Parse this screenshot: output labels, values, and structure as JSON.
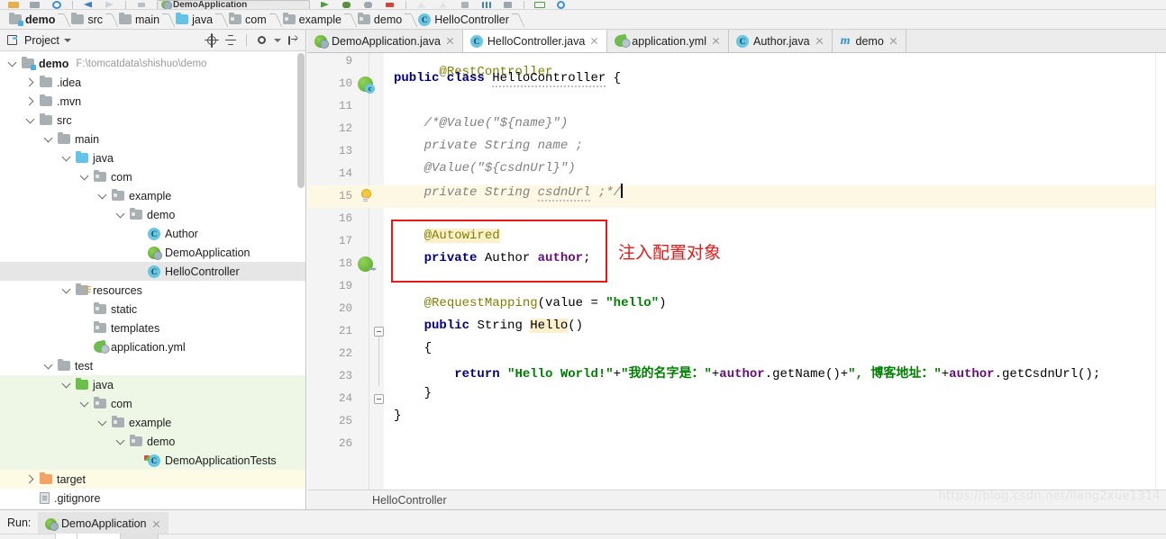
{
  "toolbar": {
    "run_config_label": "DemoApplication",
    "icons": [
      "open-folder-icon",
      "save-all-icon",
      "sync-icon",
      "back-icon",
      "forward-icon",
      "build-icon",
      "run-icon",
      "debug-icon",
      "coverage-icon",
      "stop-icon",
      "profile-icon",
      "analyze-icon",
      "update-icon",
      "structure-icon",
      "commit-icon",
      "terminal-icon",
      "search-icon"
    ]
  },
  "breadcrumb": {
    "items": [
      {
        "label": "demo",
        "icon": "module-folder-icon",
        "bold": true
      },
      {
        "label": "src",
        "icon": "folder-icon",
        "bold": false
      },
      {
        "label": "main",
        "icon": "folder-icon",
        "bold": false
      },
      {
        "label": "java",
        "icon": "source-folder-icon",
        "bold": false
      },
      {
        "label": "com",
        "icon": "package-icon",
        "bold": false
      },
      {
        "label": "example",
        "icon": "package-icon",
        "bold": false
      },
      {
        "label": "demo",
        "icon": "package-icon",
        "bold": false
      },
      {
        "label": "HelloController",
        "icon": "java-class-icon",
        "bold": false
      }
    ]
  },
  "project_panel": {
    "title": "Project",
    "toolbar_icons": [
      "locate-icon",
      "collapse-all-icon",
      "settings-icon",
      "hide-icon"
    ],
    "tree": [
      {
        "label": "demo",
        "path": "F:\\tomcatdata\\shishuo\\demo",
        "icon": "module-folder-icon",
        "indent": 0,
        "arrow": "down",
        "bold": true,
        "state": "none"
      },
      {
        "label": ".idea",
        "path": "",
        "icon": "folder-icon",
        "indent": 1,
        "arrow": "right",
        "bold": false,
        "state": "none"
      },
      {
        "label": ".mvn",
        "path": "",
        "icon": "folder-icon",
        "indent": 1,
        "arrow": "right",
        "bold": false,
        "state": "none"
      },
      {
        "label": "src",
        "path": "",
        "icon": "folder-icon",
        "indent": 1,
        "arrow": "down",
        "bold": false,
        "state": "none"
      },
      {
        "label": "main",
        "path": "",
        "icon": "folder-icon",
        "indent": 2,
        "arrow": "down",
        "bold": false,
        "state": "none"
      },
      {
        "label": "java",
        "path": "",
        "icon": "source-folder-icon",
        "indent": 3,
        "arrow": "down",
        "bold": false,
        "state": "none"
      },
      {
        "label": "com",
        "path": "",
        "icon": "package-icon",
        "indent": 4,
        "arrow": "down",
        "bold": false,
        "state": "none"
      },
      {
        "label": "example",
        "path": "",
        "icon": "package-icon",
        "indent": 5,
        "arrow": "down",
        "bold": false,
        "state": "none"
      },
      {
        "label": "demo",
        "path": "",
        "icon": "package-icon",
        "indent": 6,
        "arrow": "down",
        "bold": false,
        "state": "none"
      },
      {
        "label": "Author",
        "path": "",
        "icon": "java-class-icon",
        "indent": 7,
        "arrow": "none",
        "bold": false,
        "state": "none"
      },
      {
        "label": "DemoApplication",
        "path": "",
        "icon": "spring-boot-icon",
        "indent": 7,
        "arrow": "none",
        "bold": false,
        "state": "none"
      },
      {
        "label": "HelloController",
        "path": "",
        "icon": "java-class-icon",
        "indent": 7,
        "arrow": "none",
        "bold": false,
        "state": "selected"
      },
      {
        "label": "resources",
        "path": "",
        "icon": "resources-folder-icon",
        "indent": 3,
        "arrow": "down",
        "bold": false,
        "state": "none"
      },
      {
        "label": "static",
        "path": "",
        "icon": "package-icon",
        "indent": 4,
        "arrow": "none",
        "bold": false,
        "state": "none"
      },
      {
        "label": "templates",
        "path": "",
        "icon": "package-icon",
        "indent": 4,
        "arrow": "none",
        "bold": false,
        "state": "none"
      },
      {
        "label": "application.yml",
        "path": "",
        "icon": "spring-yaml-icon",
        "indent": 4,
        "arrow": "none",
        "bold": false,
        "state": "none"
      },
      {
        "label": "test",
        "path": "",
        "icon": "folder-icon",
        "indent": 2,
        "arrow": "down",
        "bold": false,
        "state": "none"
      },
      {
        "label": "java",
        "path": "",
        "icon": "test-source-folder-icon",
        "indent": 3,
        "arrow": "down",
        "bold": false,
        "state": "green"
      },
      {
        "label": "com",
        "path": "",
        "icon": "package-icon",
        "indent": 4,
        "arrow": "down",
        "bold": false,
        "state": "green"
      },
      {
        "label": "example",
        "path": "",
        "icon": "package-icon",
        "indent": 5,
        "arrow": "down",
        "bold": false,
        "state": "green"
      },
      {
        "label": "demo",
        "path": "",
        "icon": "package-icon",
        "indent": 6,
        "arrow": "down",
        "bold": false,
        "state": "green"
      },
      {
        "label": "DemoApplicationTests",
        "path": "",
        "icon": "java-test-class-icon",
        "indent": 7,
        "arrow": "none",
        "bold": false,
        "state": "green"
      },
      {
        "label": "target",
        "path": "",
        "icon": "excluded-folder-icon",
        "indent": 1,
        "arrow": "right",
        "bold": false,
        "state": "yellow"
      },
      {
        "label": ".gitignore",
        "path": "",
        "icon": "gitignore-file-icon",
        "indent": 1,
        "arrow": "none",
        "bold": false,
        "state": "none"
      }
    ]
  },
  "editor_tabs": [
    {
      "label": "DemoApplication.java",
      "icon": "spring-boot-icon",
      "active": false
    },
    {
      "label": "HelloController.java",
      "icon": "java-class-icon",
      "active": true
    },
    {
      "label": "application.yml",
      "icon": "spring-yaml-icon",
      "active": false
    },
    {
      "label": "Author.java",
      "icon": "java-class-icon",
      "active": false
    },
    {
      "label": "demo",
      "icon": "maven-module-icon",
      "active": false
    }
  ],
  "code": {
    "lines": [
      {
        "num": "9",
        "gutter": "none",
        "fold": "none",
        "highlight": false
      },
      {
        "num": "10",
        "gutter": "spring-bean",
        "fold": "none",
        "highlight": false
      },
      {
        "num": "11",
        "gutter": "none",
        "fold": "none",
        "highlight": false
      },
      {
        "num": "12",
        "gutter": "none",
        "fold": "none",
        "highlight": false
      },
      {
        "num": "13",
        "gutter": "none",
        "fold": "none",
        "highlight": false
      },
      {
        "num": "14",
        "gutter": "none",
        "fold": "none",
        "highlight": false
      },
      {
        "num": "15",
        "gutter": "bulb",
        "fold": "none",
        "highlight": true
      },
      {
        "num": "16",
        "gutter": "none",
        "fold": "none",
        "highlight": false
      },
      {
        "num": "17",
        "gutter": "none",
        "fold": "none",
        "highlight": false
      },
      {
        "num": "18",
        "gutter": "spring-autowired",
        "fold": "none",
        "highlight": false
      },
      {
        "num": "19",
        "gutter": "none",
        "fold": "none",
        "highlight": false
      },
      {
        "num": "20",
        "gutter": "none",
        "fold": "none",
        "highlight": false
      },
      {
        "num": "21",
        "gutter": "none",
        "fold": "start",
        "highlight": false
      },
      {
        "num": "22",
        "gutter": "none",
        "fold": "none",
        "highlight": false
      },
      {
        "num": "23",
        "gutter": "none",
        "fold": "none",
        "highlight": false
      },
      {
        "num": "24",
        "gutter": "none",
        "fold": "end",
        "highlight": false
      },
      {
        "num": "25",
        "gutter": "none",
        "fold": "none",
        "highlight": false
      },
      {
        "num": "26",
        "gutter": "none",
        "fold": "none",
        "highlight": false
      }
    ],
    "text": {
      "l9": "@RestController",
      "l10": "public class HelloController {",
      "l12": "/*@Value(\"${name}\")",
      "l13": "private String name ;",
      "l14": "@Value(\"${csdnUrl}\")",
      "l15": "private String csdnUrl ;*/",
      "l17": "@Autowired",
      "l18": "private Author author;",
      "l20": "@RequestMapping(value = \"hello\")",
      "l21": "public String Hello()",
      "l22": "{",
      "l23": "return \"Hello World!\"+\"我的名字是：\"+author.getName()+\", 博客地址：\"+author.getCsdnUrl();",
      "l24": "}",
      "l25": "}"
    }
  },
  "annotation": {
    "note_text": "注入配置对象",
    "box_color": "#e81919"
  },
  "editor_status": {
    "breadcrumb": "HelloController"
  },
  "run_panel": {
    "label": "Run:",
    "tab_label": "DemoApplication"
  },
  "watermark": "https://blog.csdn.net/liang2xue1314",
  "colors": {
    "accent_blue": "#62c4e8",
    "spring_green": "#6cbf4b",
    "annotation_red": "#e81919",
    "selection_gray": "#e6e6e6",
    "line_highlight": "#fdf8e3",
    "test_green_bg": "#eef7e6",
    "excluded_yellow_bg": "#fdfbe6"
  }
}
